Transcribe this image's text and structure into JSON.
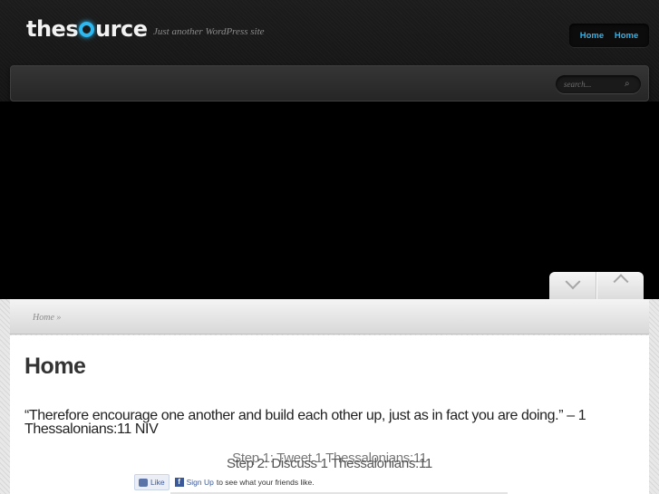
{
  "site": {
    "logo_text_a": "thes",
    "logo_text_b": "urce",
    "tagline": "Just another WordPress site"
  },
  "nav": {
    "items": [
      {
        "label": "Home"
      },
      {
        "label": "Home"
      }
    ]
  },
  "search": {
    "placeholder": "search..."
  },
  "breadcrumb": {
    "text": "Home »"
  },
  "page": {
    "title": "Home",
    "quote": "“Therefore encourage one another and build each other up, just as in fact you are doing.” – 1 Thessalonians:11 NIV",
    "step1": "Step 1: Tweet 1 Thessalonians:11",
    "step2": "Step 2: Discuss 1 Thessalonians:11"
  },
  "facebook": {
    "like_label": "Like",
    "signup_label": "Sign Up",
    "signup_suffix": "to see what your friends like."
  },
  "colors": {
    "accent": "#2fb3ea",
    "facebook": "#3b5998"
  }
}
